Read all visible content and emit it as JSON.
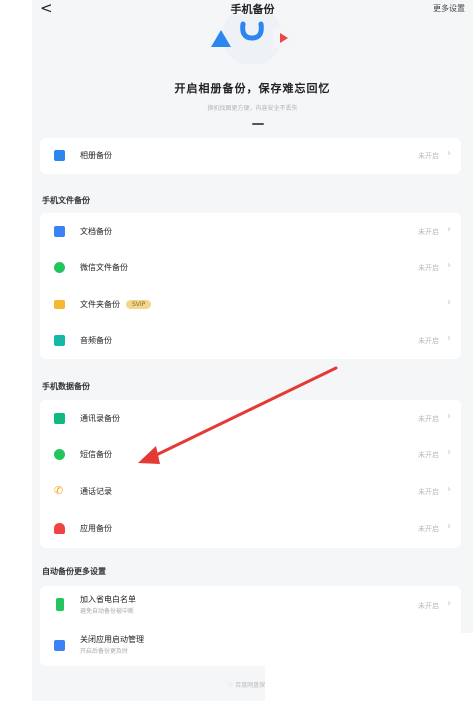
{
  "header": {
    "back_label": "<",
    "title": "手机备份",
    "more_label": "更多设置"
  },
  "hero": {
    "title": "开启相册备份，保存难忘回忆",
    "subtitle": "换机找图更方便，内容安全不丢失"
  },
  "album": {
    "label": "相册备份",
    "status": "未开启"
  },
  "sections": {
    "files": "手机文件备份",
    "data": "手机数据备份",
    "auto": "自动备份更多设置"
  },
  "file_items": [
    {
      "label": "文档备份",
      "status": "未开启",
      "icon": "document-icon",
      "color": "#3b82f6"
    },
    {
      "label": "微信文件备份",
      "status": "未开启",
      "icon": "wechat-icon",
      "color": "#22c55e"
    },
    {
      "label": "文件夹备份",
      "badge": "SVIP",
      "status": "",
      "icon": "folder-icon",
      "color": "#f5b82e"
    },
    {
      "label": "音频备份",
      "status": "未开启",
      "icon": "audio-icon",
      "color": "#14b8a6"
    }
  ],
  "data_items": [
    {
      "label": "通讯录备份",
      "status": "未开启",
      "icon": "contacts-icon",
      "color": "#10b981"
    },
    {
      "label": "短信备份",
      "status": "未开启",
      "icon": "sms-icon",
      "color": "#22c55e"
    },
    {
      "label": "通话记录",
      "status": "未开启",
      "icon": "phone-icon",
      "color": "#f59e0b"
    },
    {
      "label": "应用备份",
      "status": "未开启",
      "icon": "app-icon",
      "color": "#ef4444"
    }
  ],
  "auto_items": [
    {
      "label": "加入省电白名单",
      "sub": "避免自动备份被中断",
      "status": "未开启",
      "icon": "battery-icon",
      "color": "#22c55e"
    },
    {
      "label": "关闭应用启动管理",
      "sub": "开启后备份更及时",
      "status": "",
      "icon": "app-manage-icon",
      "color": "#3b82f6"
    }
  ],
  "footer": {
    "text": "百度网盘保障你"
  },
  "colors": {
    "annotation_arrow": "#e53935"
  }
}
